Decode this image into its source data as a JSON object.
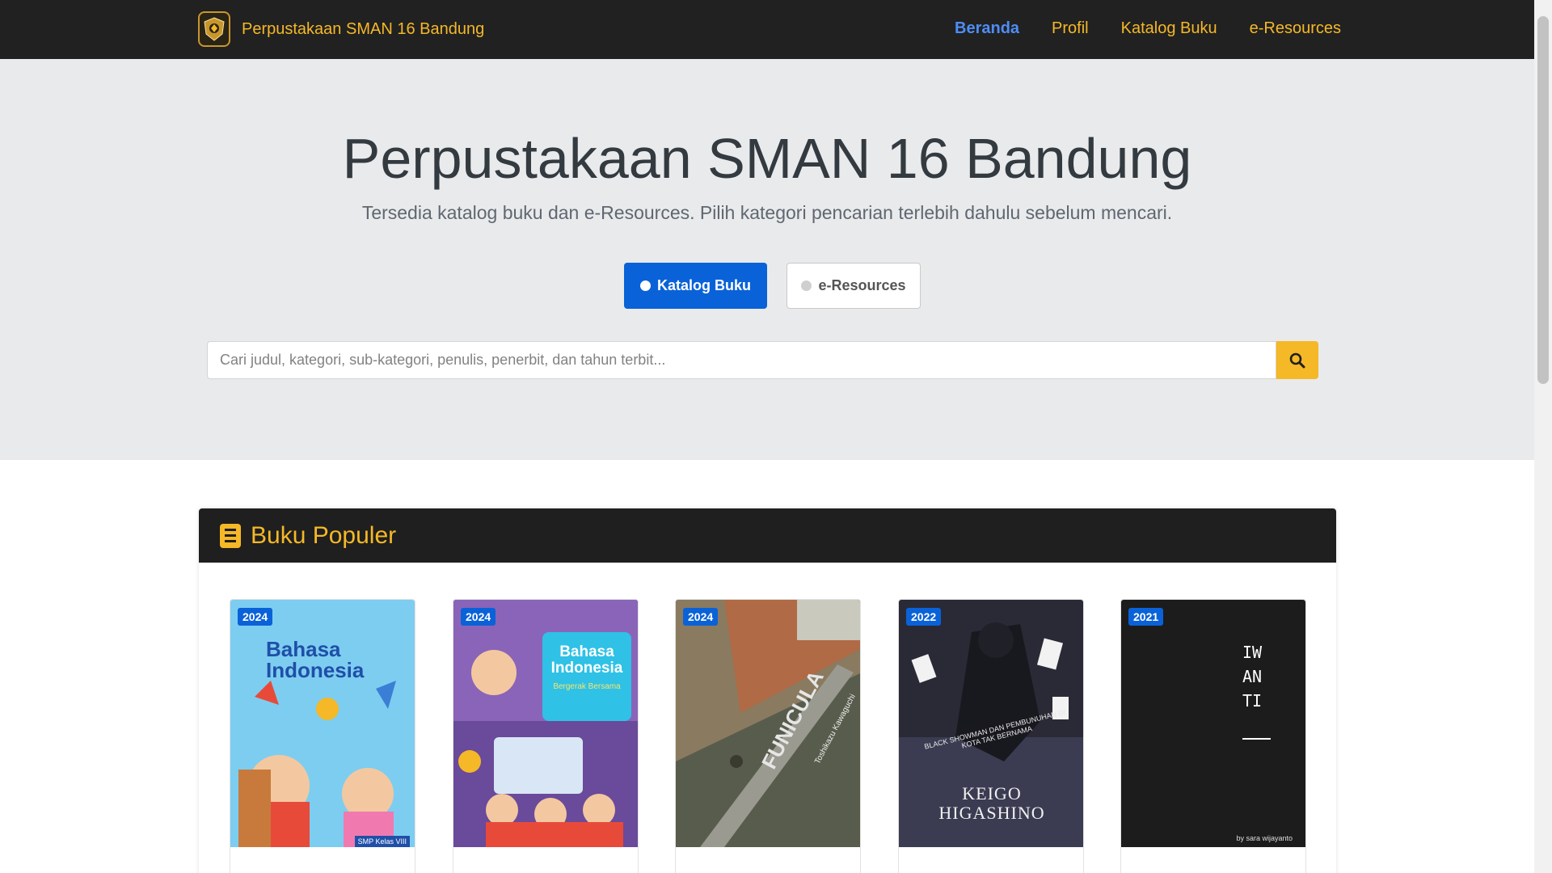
{
  "brand": {
    "name": "Perpustakaan SMAN 16 Bandung",
    "logo_icon": "school-emblem-icon"
  },
  "nav": [
    {
      "label": "Beranda",
      "active": true
    },
    {
      "label": "Profil",
      "active": false
    },
    {
      "label": "Katalog Buku",
      "active": false
    },
    {
      "label": "e-Resources",
      "active": false
    }
  ],
  "hero": {
    "title": "Perpustakaan SMAN 16 Bandung",
    "subtitle": "Tersedia katalog buku dan e-Resources. Pilih kategori pencarian terlebih dahulu sebelum mencari.",
    "btn_katalog": "Katalog Buku",
    "btn_eresources": "e-Resources"
  },
  "search": {
    "placeholder": "Cari judul, kategori, sub-kategori, penulis, penerbit, dan tahun terbit...",
    "icon": "search-icon"
  },
  "popular": {
    "title": "Buku Populer",
    "icon": "book-icon",
    "books": [
      {
        "year": "2024",
        "cover_title": "Bahasa Indonesia",
        "cover_sub": "SMP Kelas VIII"
      },
      {
        "year": "2024",
        "cover_title": "Bahasa Indonesia",
        "cover_sub": "Bergerak Bersama"
      },
      {
        "year": "2024",
        "cover_title": "FUNICULA",
        "cover_sub": "Toshikazu Kawaguchi"
      },
      {
        "year": "2022",
        "cover_title": "KEIGO HIGASHINO",
        "cover_sub": "BLACK SHOWMAN DAN PEMBUNUHAN DI KOTA TAK BERNAMA"
      },
      {
        "year": "2021",
        "cover_title": "IWANTI",
        "cover_sub": "by sara wijayanto"
      }
    ]
  },
  "colors": {
    "accent": "#f5b827",
    "primary": "#0a62d8",
    "navbar": "#212121",
    "hero_bg": "#e9eaec"
  }
}
